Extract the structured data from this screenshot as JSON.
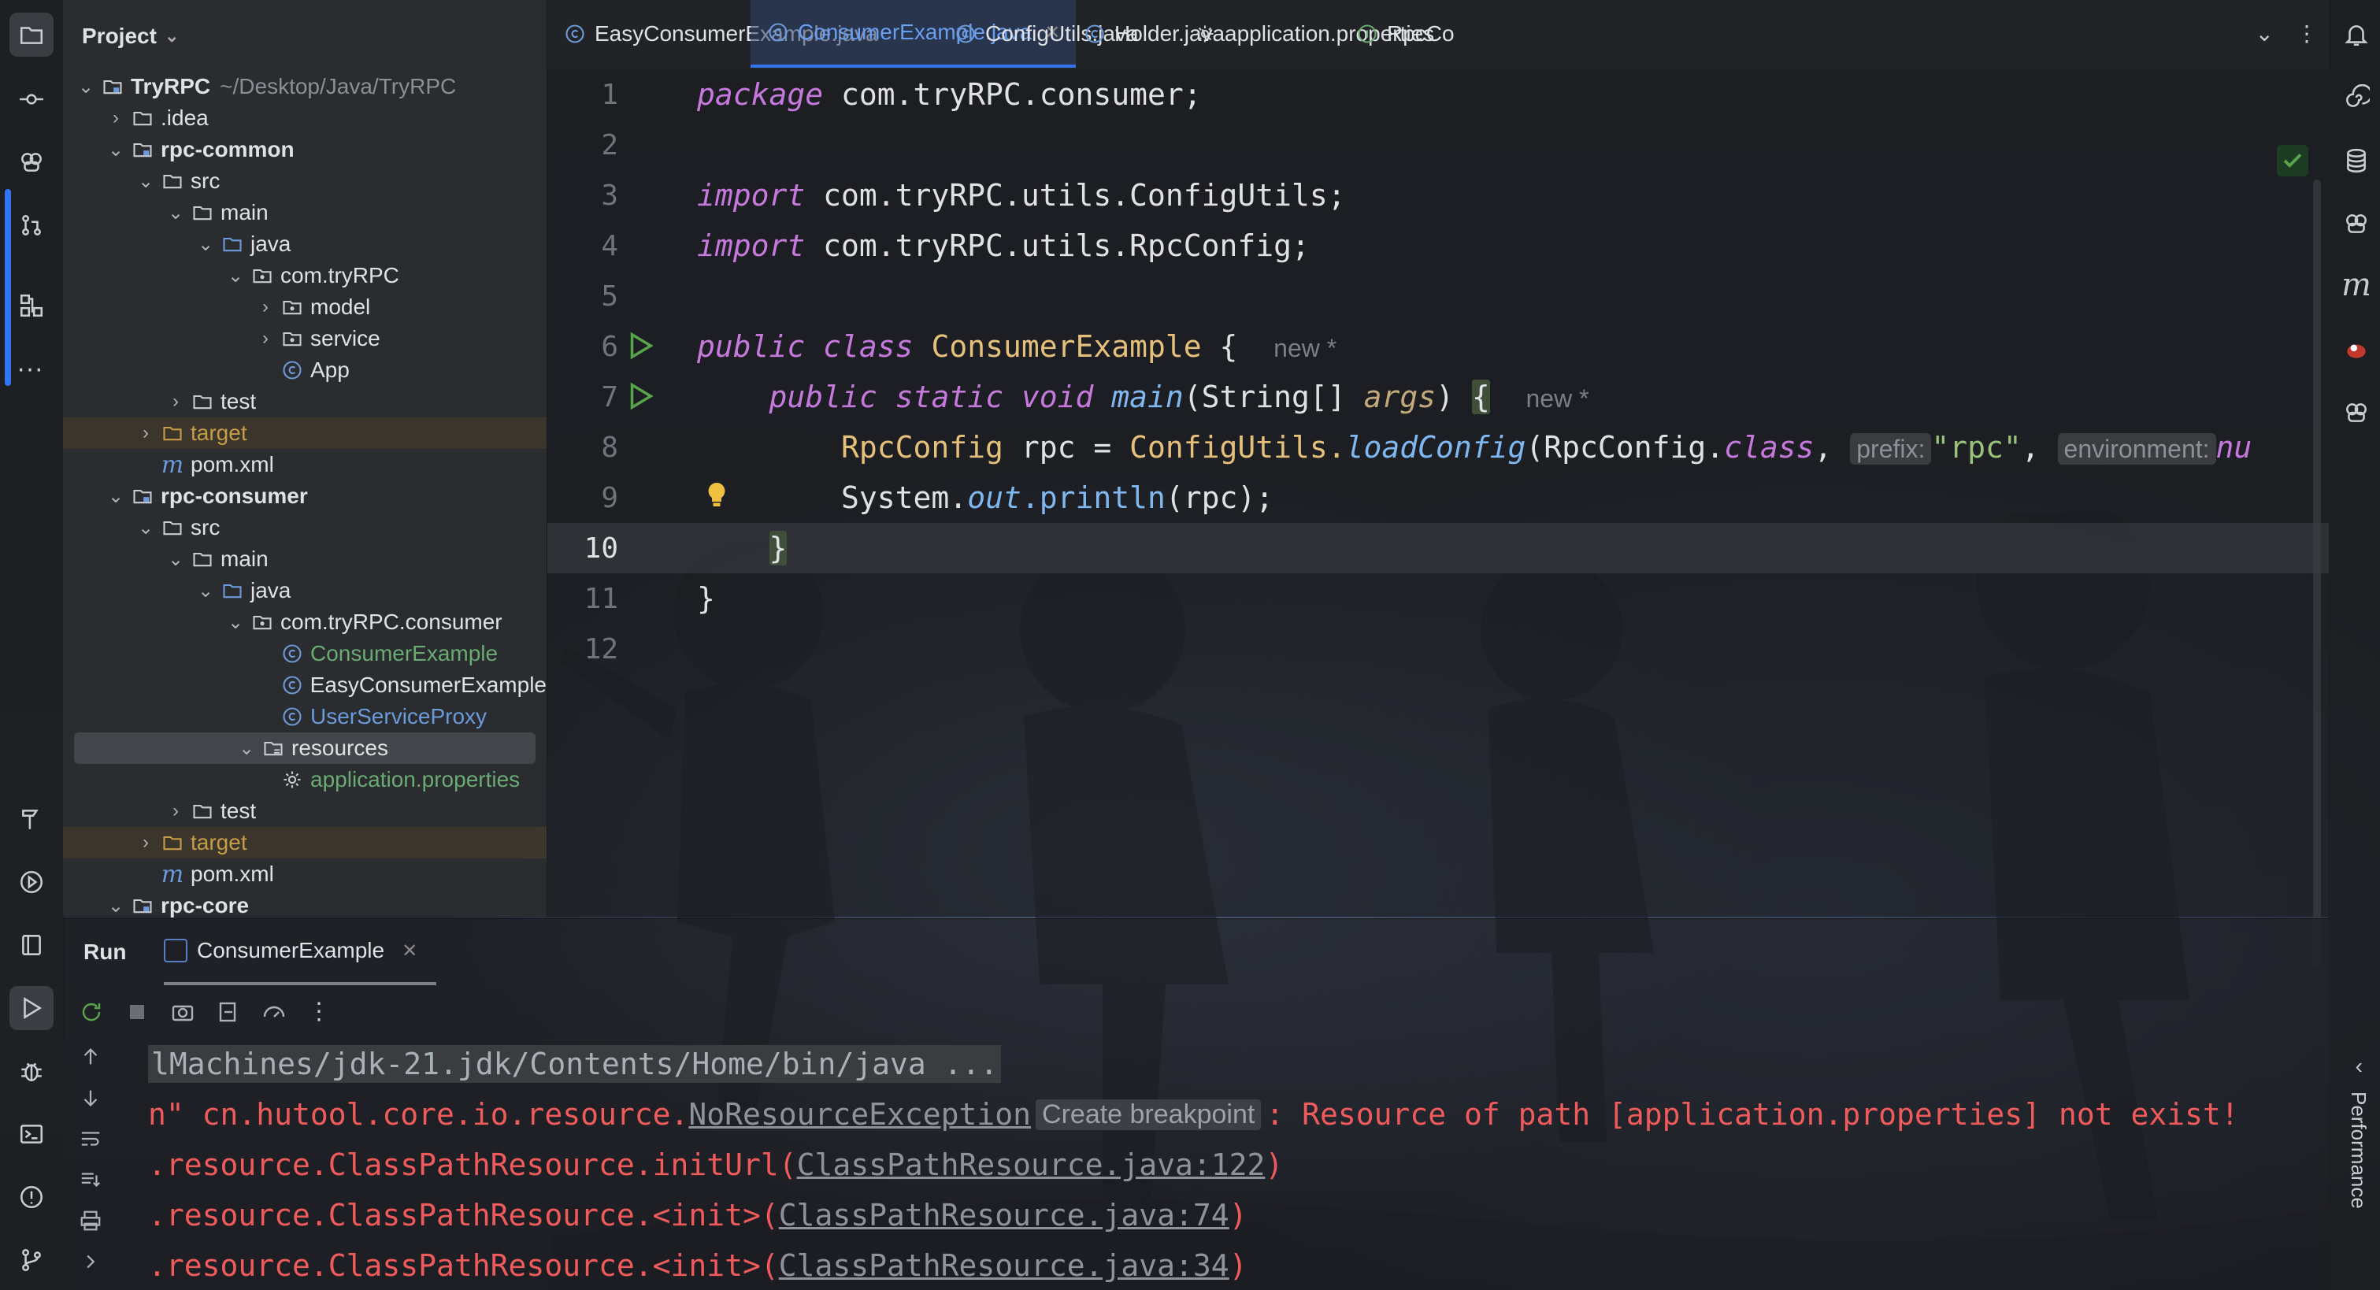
{
  "project": {
    "header": "Project",
    "tree": [
      {
        "label": "TryRPC",
        "path": "~/Desktop/Java/TryRPC",
        "depth": 0,
        "arrow": "open",
        "icon": "module-folder",
        "bold": true
      },
      {
        "label": ".idea",
        "depth": 1,
        "arrow": "closed",
        "icon": "folder"
      },
      {
        "label": "rpc-common",
        "depth": 1,
        "arrow": "open",
        "icon": "module-folder",
        "bold": true
      },
      {
        "label": "src",
        "depth": 2,
        "arrow": "open",
        "icon": "folder"
      },
      {
        "label": "main",
        "depth": 3,
        "arrow": "open",
        "icon": "folder"
      },
      {
        "label": "java",
        "depth": 4,
        "arrow": "open",
        "icon": "source-folder"
      },
      {
        "label": "com.tryRPC",
        "depth": 5,
        "arrow": "open",
        "icon": "package"
      },
      {
        "label": "model",
        "depth": 6,
        "arrow": "closed",
        "icon": "package"
      },
      {
        "label": "service",
        "depth": 6,
        "arrow": "closed",
        "icon": "package"
      },
      {
        "label": "App",
        "depth": 6,
        "arrow": "none",
        "icon": "class"
      },
      {
        "label": "test",
        "depth": 3,
        "arrow": "closed",
        "icon": "folder"
      },
      {
        "label": "target",
        "depth": 2,
        "arrow": "closed",
        "icon": "excluded-folder",
        "excluded": true
      },
      {
        "label": "pom.xml",
        "depth": 2,
        "arrow": "none",
        "icon": "maven"
      },
      {
        "label": "rpc-consumer",
        "depth": 1,
        "arrow": "open",
        "icon": "module-folder",
        "bold": true
      },
      {
        "label": "src",
        "depth": 2,
        "arrow": "open",
        "icon": "folder"
      },
      {
        "label": "main",
        "depth": 3,
        "arrow": "open",
        "icon": "folder"
      },
      {
        "label": "java",
        "depth": 4,
        "arrow": "open",
        "icon": "source-folder"
      },
      {
        "label": "com.tryRPC.consumer",
        "depth": 5,
        "arrow": "open",
        "icon": "package"
      },
      {
        "label": "ConsumerExample",
        "depth": 6,
        "arrow": "none",
        "icon": "class",
        "color": "green"
      },
      {
        "label": "EasyConsumerExample",
        "depth": 6,
        "arrow": "none",
        "icon": "class"
      },
      {
        "label": "UserServiceProxy",
        "depth": 6,
        "arrow": "none",
        "icon": "class",
        "color": "blue"
      },
      {
        "label": "resources",
        "depth": 5,
        "arrow": "open",
        "icon": "resources-folder",
        "selected": true
      },
      {
        "label": "application.properties",
        "depth": 6,
        "arrow": "none",
        "icon": "settings",
        "color": "green"
      },
      {
        "label": "test",
        "depth": 3,
        "arrow": "closed",
        "icon": "folder"
      },
      {
        "label": "target",
        "depth": 2,
        "arrow": "closed",
        "icon": "excluded-folder",
        "excluded": true
      },
      {
        "label": "pom.xml",
        "depth": 2,
        "arrow": "none",
        "icon": "maven"
      },
      {
        "label": "rpc-core",
        "depth": 1,
        "arrow": "open",
        "icon": "module-folder",
        "bold": true
      }
    ]
  },
  "tabs": [
    {
      "label": "EasyConsumerExample.java",
      "icon": "class",
      "active": false
    },
    {
      "label": "ConsumerExample.java",
      "icon": "class",
      "active": true
    },
    {
      "label": "ConfigUtils.java",
      "icon": "class",
      "active": false
    },
    {
      "label": "Holder.java",
      "icon": "class",
      "active": false
    },
    {
      "label": "application.properties",
      "icon": "settings",
      "active": false
    },
    {
      "label": "RpcCo",
      "icon": "interface",
      "active": false
    }
  ],
  "editor": {
    "current_line": 10,
    "line_numbers": [
      "1",
      "2",
      "3",
      "4",
      "5",
      "6",
      "7",
      "8",
      "9",
      "10",
      "11",
      "12"
    ],
    "line1": {
      "kw": "package",
      "rest": " com.tryRPC.consumer;"
    },
    "line3": {
      "kw": "import",
      "rest": " com.tryRPC.utils.ConfigUtils;"
    },
    "line4": {
      "kw": "import",
      "rest": " com.tryRPC.utils.RpcConfig;"
    },
    "line6": {
      "kw1": "public",
      "kw2": "class",
      "name": "ConsumerExample",
      "brace": " {",
      "hint": "new *"
    },
    "line7": {
      "kw1": "public",
      "kw2": "static",
      "kw3": "void",
      "name": "main",
      "open": "(String[] ",
      "param": "args",
      "close": ") ",
      "brace": "{",
      "hint": "new *"
    },
    "line8": {
      "type": "RpcConfig",
      "var": " rpc = ",
      "cls": "ConfigUtils.",
      "method": "loadConfig",
      "arg1": "(RpcConfig.",
      "kw": "class",
      "sep": ", ",
      "hint1": "prefix:",
      "str": "\"rpc\"",
      "sep2": ", ",
      "hint2": "environment:",
      "tail": "nu"
    },
    "line9": {
      "pre": "System.",
      "field": "out",
      "method": ".println",
      "args": "(rpc);"
    },
    "line10": {
      "brace": "}"
    },
    "line11": {
      "brace": "}"
    }
  },
  "run": {
    "title": "Run",
    "tab_label": "ConsumerExample",
    "console": {
      "cmd": "lMachines/jdk-21.jdk/Contents/Home/bin/java ...",
      "err_prefix": "n\" cn.hutool.core.io.resource.",
      "err_link": "NoResourceException",
      "tooltip": "Create breakpoint",
      "err_suffix": ": Resource of path [application.properties] not exist!",
      "stack": [
        {
          "pre": ".resource.ClassPathResource.initUrl(",
          "link": "ClassPathResource.java:122",
          "post": ")"
        },
        {
          "pre": ".resource.ClassPathResource.<init>(",
          "link": "ClassPathResource.java:74",
          "post": ")"
        },
        {
          "pre": ".resource.ClassPathResource.<init>(",
          "link": "ClassPathResource.java:34",
          "post": ")"
        }
      ]
    }
  },
  "right_strip": {
    "performance_label": "Performance"
  },
  "colors": {
    "accent": "#3574f0",
    "error": "#ef5b5b",
    "keyword": "#c679dd",
    "string": "#98c379",
    "run_green": "#57a64a"
  }
}
